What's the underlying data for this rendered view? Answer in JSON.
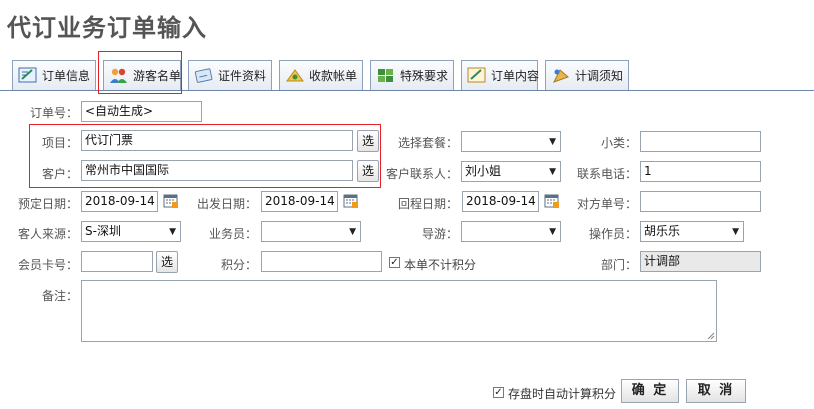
{
  "page": {
    "title": "代订业务订单输入"
  },
  "tabs": [
    {
      "label": "订单信息",
      "icon": "order-info-icon"
    },
    {
      "label": "游客名单",
      "icon": "tourist-list-icon"
    },
    {
      "label": "证件资料",
      "icon": "document-icon"
    },
    {
      "label": "收款帐单",
      "icon": "payment-bill-icon"
    },
    {
      "label": "特殊要求",
      "icon": "special-request-icon"
    },
    {
      "label": "订单内容",
      "icon": "order-content-icon"
    },
    {
      "label": "计调须知",
      "icon": "notice-icon"
    }
  ],
  "form": {
    "order_no": {
      "label": "订单号：",
      "value": "<自动生成>"
    },
    "project": {
      "label": "项目：",
      "value": "代订门票",
      "button": "选"
    },
    "customer": {
      "label": "客户：",
      "value": "常州市中国国际",
      "button": "选"
    },
    "package": {
      "label": "选择套餐：",
      "value": ""
    },
    "subcategory": {
      "label": "小类：",
      "value": ""
    },
    "contact": {
      "label": "客户联系人：",
      "value": "刘小姐"
    },
    "phone": {
      "label": "联系电话：",
      "value": "1"
    },
    "book_date": {
      "label": "预定日期：",
      "value": "2018-09-14"
    },
    "depart_date": {
      "label": "出发日期：",
      "value": "2018-09-14"
    },
    "return_date": {
      "label": "回程日期：",
      "value": "2018-09-14"
    },
    "counter_no": {
      "label": "对方单号：",
      "value": ""
    },
    "source": {
      "label": "客人来源：",
      "value": "S-深圳"
    },
    "salesman": {
      "label": "业务员：",
      "value": ""
    },
    "guide": {
      "label": "导游：",
      "value": ""
    },
    "operator": {
      "label": "操作员：",
      "value": "胡乐乐"
    },
    "member_card": {
      "label": "会员卡号：",
      "value": "",
      "button": "选"
    },
    "points": {
      "label": "积分：",
      "value": ""
    },
    "no_points": {
      "label": "本单不计积分",
      "checked": true
    },
    "department": {
      "label": "部门：",
      "value": "计调部"
    },
    "remark": {
      "label": "备注：",
      "value": ""
    }
  },
  "footer": {
    "auto_points": {
      "label": "存盘时自动计算积分",
      "checked": true
    },
    "confirm": "确 定",
    "cancel": "取 消"
  },
  "colors": {
    "highlight": "#e3212a",
    "tab_border": "#8ea0bb"
  }
}
